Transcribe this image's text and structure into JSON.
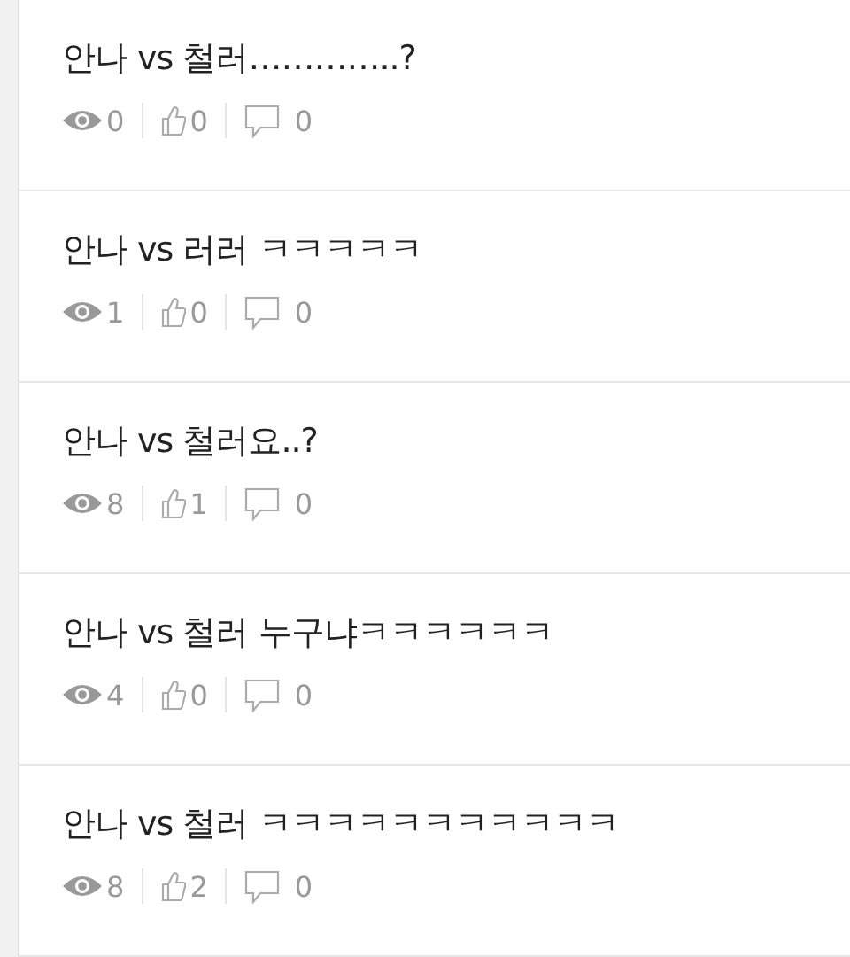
{
  "posts": [
    {
      "title": "안나 vs 철러…………..?",
      "views": "0",
      "likes": "0",
      "comments": "0"
    },
    {
      "title": "안나 vs 러러 ㅋㅋㅋㅋㅋ",
      "views": "1",
      "likes": "0",
      "comments": "0"
    },
    {
      "title": "안나 vs 철러요..?",
      "views": "8",
      "likes": "1",
      "comments": "0"
    },
    {
      "title": "안나 vs 철러 누구냐ㅋㅋㅋㅋㅋㅋ",
      "views": "4",
      "likes": "0",
      "comments": "0"
    },
    {
      "title": "안나 vs 철러 ㅋㅋㅋㅋㅋㅋㅋㅋㅋㅋㅋ",
      "views": "8",
      "likes": "2",
      "comments": "0"
    }
  ]
}
